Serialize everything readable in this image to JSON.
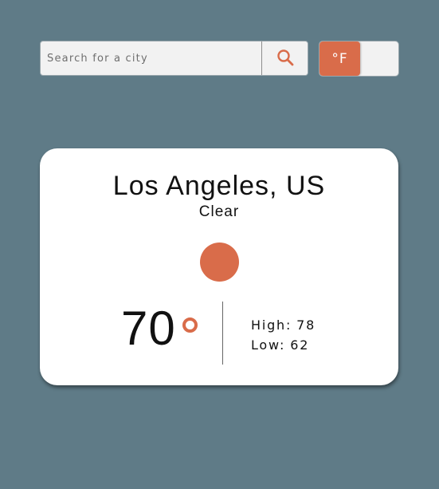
{
  "search": {
    "placeholder": "Search for a city",
    "value": ""
  },
  "unit_toggle": {
    "selected_label": "°F"
  },
  "weather": {
    "city": "Los Angeles, US",
    "condition": "Clear",
    "icon": "sun-icon",
    "temperature": "70",
    "high_label": "High:",
    "high_value": "78",
    "low_label": "Low:",
    "low_value": "62"
  },
  "colors": {
    "background": "#5f7b87",
    "accent": "#d96c4a",
    "card": "#ffffff"
  }
}
